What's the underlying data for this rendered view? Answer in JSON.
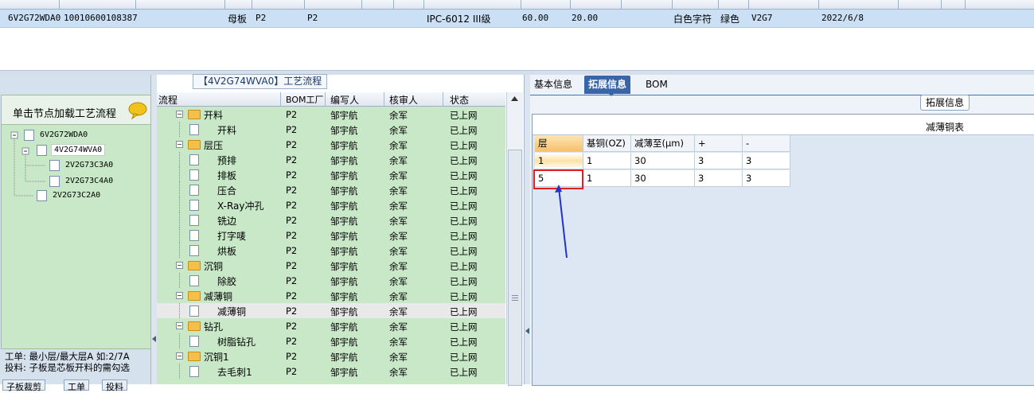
{
  "top_grid": {
    "row": {
      "code": "6V2G72WDA0",
      "number": "10010600108387",
      "type": "母板",
      "factory1": "P2",
      "factory2": "P2",
      "grade": "IPC-6012 III级",
      "value1": "60.00",
      "value2": "20.00",
      "char_color": "白色字符",
      "solder_color": "绿色",
      "version": "V2G7",
      "date": "2022/6/8"
    }
  },
  "left_panel": {
    "title": "单击节点加载工艺流程",
    "tree": [
      "6V2G72WDA0",
      "4V2G74WVA0",
      "2V2G73C3A0",
      "2V2G73C4A0",
      "2V2G73C2A0"
    ],
    "note_line1": "工单: 最小层/最大层A 如:2/7A",
    "note_line2": "投料: 子板是芯板开料的需勾选",
    "tabs": [
      "子板裁剪",
      "工单",
      "投料"
    ]
  },
  "process": {
    "title": "【4V2G74WVA0】工艺流程",
    "headers": [
      "流程",
      "BOM工厂",
      "编写人",
      "核审人",
      "状态"
    ],
    "rows": [
      {
        "name": "开料",
        "level": 0,
        "factory": "P2",
        "writer": "邹宇航",
        "reviewer": "余军",
        "status": "已上网"
      },
      {
        "name": "开料",
        "level": 1,
        "factory": "P2",
        "writer": "邹宇航",
        "reviewer": "余军",
        "status": "已上网"
      },
      {
        "name": "层压",
        "level": 0,
        "factory": "P2",
        "writer": "邹宇航",
        "reviewer": "余军",
        "status": "已上网"
      },
      {
        "name": "预排",
        "level": 1,
        "factory": "P2",
        "writer": "邹宇航",
        "reviewer": "余军",
        "status": "已上网"
      },
      {
        "name": "排板",
        "level": 1,
        "factory": "P2",
        "writer": "邹宇航",
        "reviewer": "余军",
        "status": "已上网"
      },
      {
        "name": "压合",
        "level": 1,
        "factory": "P2",
        "writer": "邹宇航",
        "reviewer": "余军",
        "status": "已上网"
      },
      {
        "name": "X-Ray冲孔",
        "level": 1,
        "factory": "P2",
        "writer": "邹宇航",
        "reviewer": "余军",
        "status": "已上网"
      },
      {
        "name": "铣边",
        "level": 1,
        "factory": "P2",
        "writer": "邹宇航",
        "reviewer": "余军",
        "status": "已上网"
      },
      {
        "name": "打字唛",
        "level": 1,
        "factory": "P2",
        "writer": "邹宇航",
        "reviewer": "余军",
        "status": "已上网"
      },
      {
        "name": "烘板",
        "level": 1,
        "factory": "P2",
        "writer": "邹宇航",
        "reviewer": "余军",
        "status": "已上网"
      },
      {
        "name": "沉铜",
        "level": 0,
        "factory": "P2",
        "writer": "邹宇航",
        "reviewer": "余军",
        "status": "已上网"
      },
      {
        "name": "除胶",
        "level": 1,
        "factory": "P2",
        "writer": "邹宇航",
        "reviewer": "余军",
        "status": "已上网"
      },
      {
        "name": "减薄铜",
        "level": 0,
        "factory": "P2",
        "writer": "邹宇航",
        "reviewer": "余军",
        "status": "已上网"
      },
      {
        "name": "减薄铜",
        "level": 1,
        "factory": "P2",
        "writer": "邹宇航",
        "reviewer": "余军",
        "status": "已上网",
        "selected": true
      },
      {
        "name": "钻孔",
        "level": 0,
        "factory": "P2",
        "writer": "邹宇航",
        "reviewer": "余军",
        "status": "已上网"
      },
      {
        "name": "树脂钻孔",
        "level": 1,
        "factory": "P2",
        "writer": "邹宇航",
        "reviewer": "余军",
        "status": "已上网"
      },
      {
        "name": "沉铜1",
        "level": 0,
        "factory": "P2",
        "writer": "邹宇航",
        "reviewer": "余军",
        "status": "已上网"
      },
      {
        "name": "去毛刺1",
        "level": 1,
        "factory": "P2",
        "writer": "邹宇航",
        "reviewer": "余军",
        "status": "已上网"
      }
    ]
  },
  "detail": {
    "tabs": [
      "基本信息",
      "拓展信息",
      "BOM"
    ],
    "active_tab": "拓展信息",
    "ext_label": "拓展信息",
    "table_caption": "减薄铜表",
    "grid_headers": [
      "层",
      "基铜(OZ)",
      "减薄至(μm)",
      "+",
      "-"
    ],
    "grid_rows": [
      [
        "1",
        "1",
        "30",
        "3",
        "3"
      ],
      [
        "5",
        "1",
        "30",
        "3",
        "3"
      ]
    ]
  },
  "colors": {
    "accent": "#3a64a8",
    "green_panel": "#c8e8c8",
    "highlight_box": "#e02020",
    "arrow": "#2233cc"
  }
}
